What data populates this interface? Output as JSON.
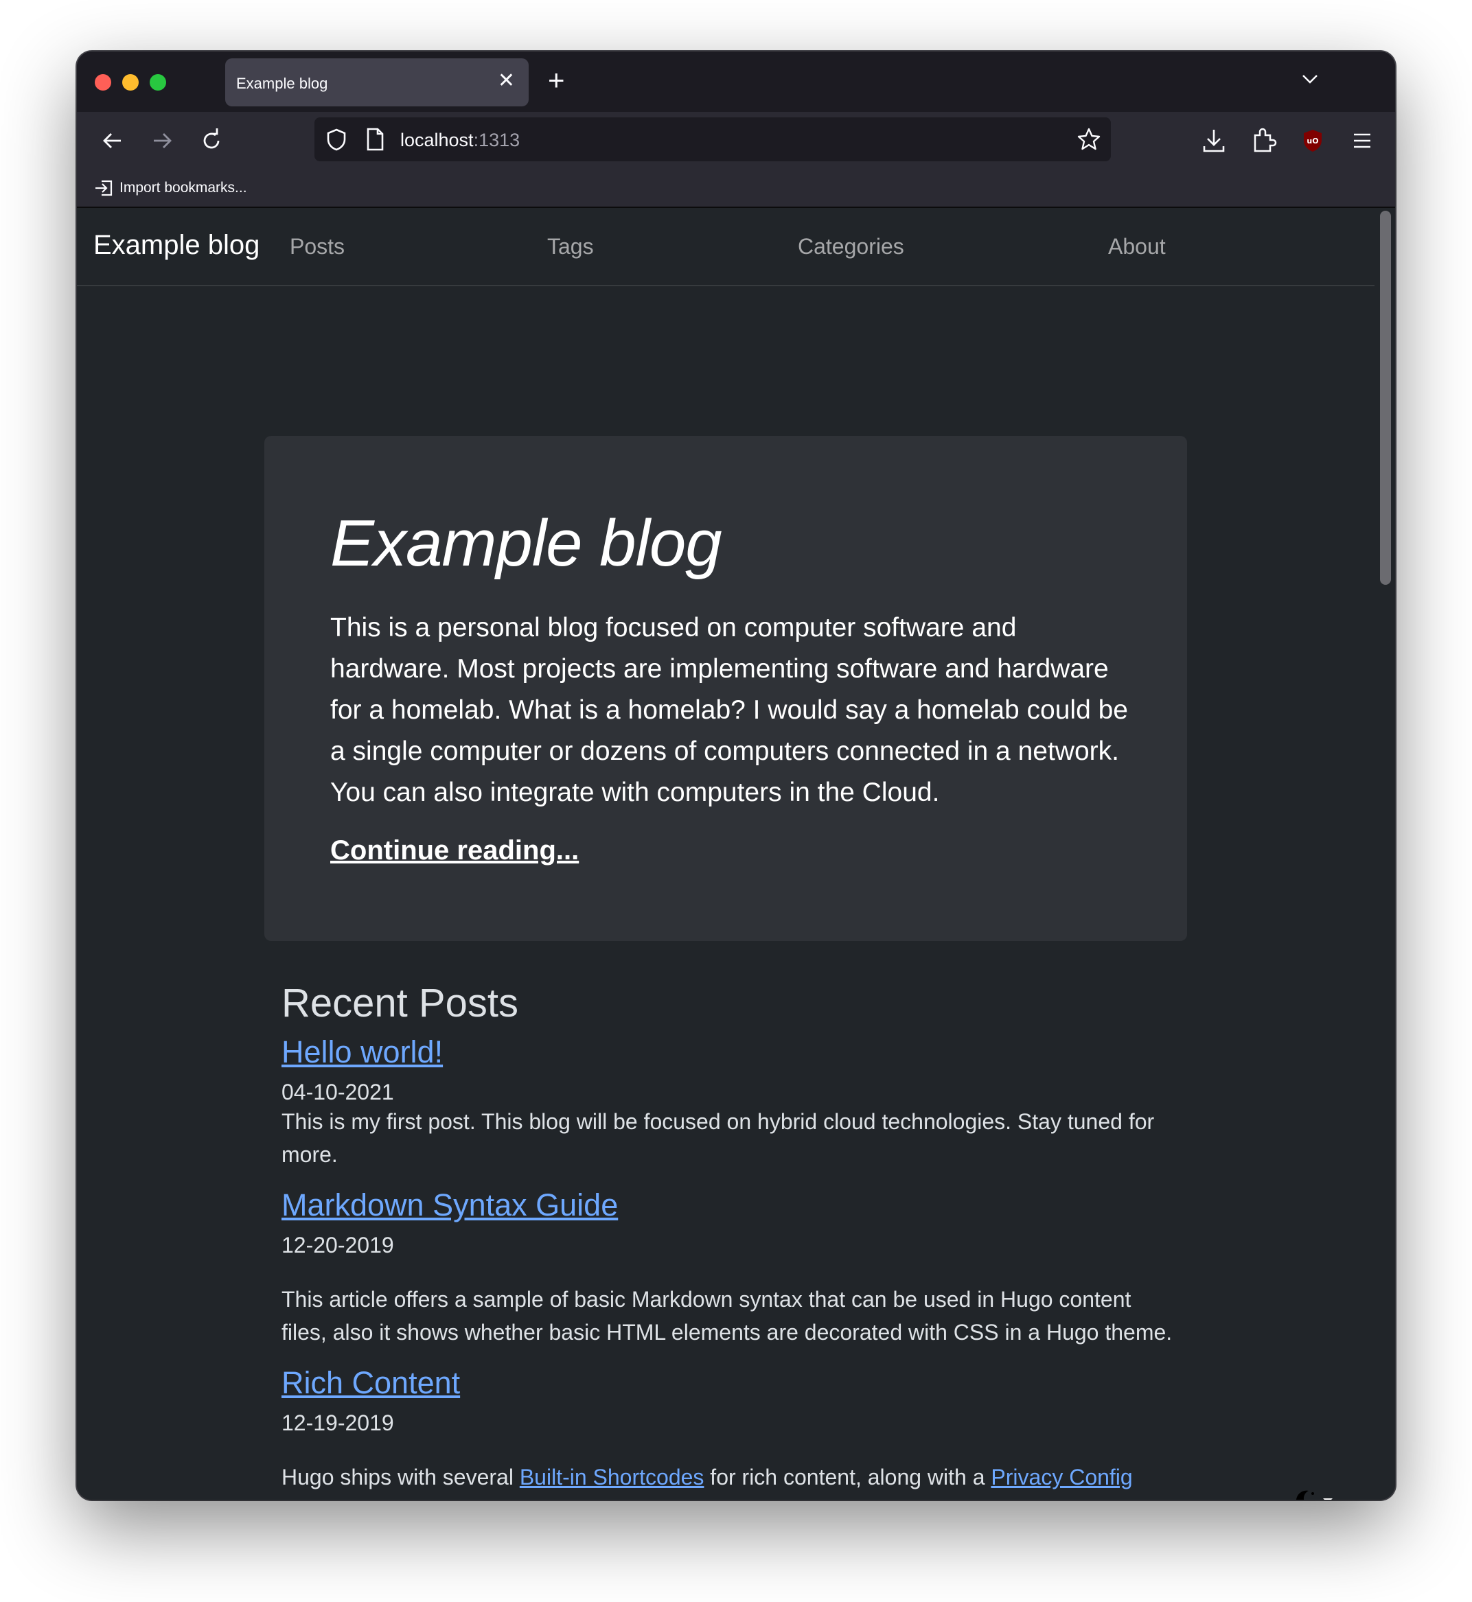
{
  "browser": {
    "tab_title": "Example blog",
    "url_host": "localhost",
    "url_port": ":1313",
    "bookmark_label": "Import bookmarks..."
  },
  "site": {
    "brand": "Example blog",
    "nav": [
      "Posts",
      "Tags",
      "Categories",
      "About"
    ]
  },
  "jumbotron": {
    "title": "Example blog",
    "description": "This is a personal blog focused on computer software and hardware. Most projects are implementing software and hardware for a homelab. What is a homelab? I would say a homelab could be a single computer or dozens of computers connected in a network. You can also integrate with computers in the Cloud.",
    "cta": "Continue reading..."
  },
  "recent": {
    "heading": "Recent Posts",
    "posts": [
      {
        "title": "Hello world!",
        "date": "04-10-2021",
        "summary": "This is my first post. This blog will be focused on hybrid cloud technologies. Stay tuned for more."
      },
      {
        "title": "Markdown Syntax Guide",
        "date": "12-20-2019",
        "summary": "This article offers a sample of basic Markdown syntax that can be used in Hugo content files, also it shows whether basic HTML elements are decorated with CSS in a Hugo theme."
      },
      {
        "title": "Rich Content",
        "date": "12-19-2019",
        "summary_prefix": "Hugo ships with several ",
        "summary_link1": "Built-in Shortcodes",
        "summary_mid": " for rich content, along with a ",
        "summary_link2": "Privacy Config"
      }
    ]
  },
  "colors": {
    "page_bg": "#212529",
    "card_bg": "#2f3237",
    "link": "#6ea8fe",
    "chrome_dark": "#1c1b22",
    "chrome_toolbar": "#2b2a33"
  }
}
